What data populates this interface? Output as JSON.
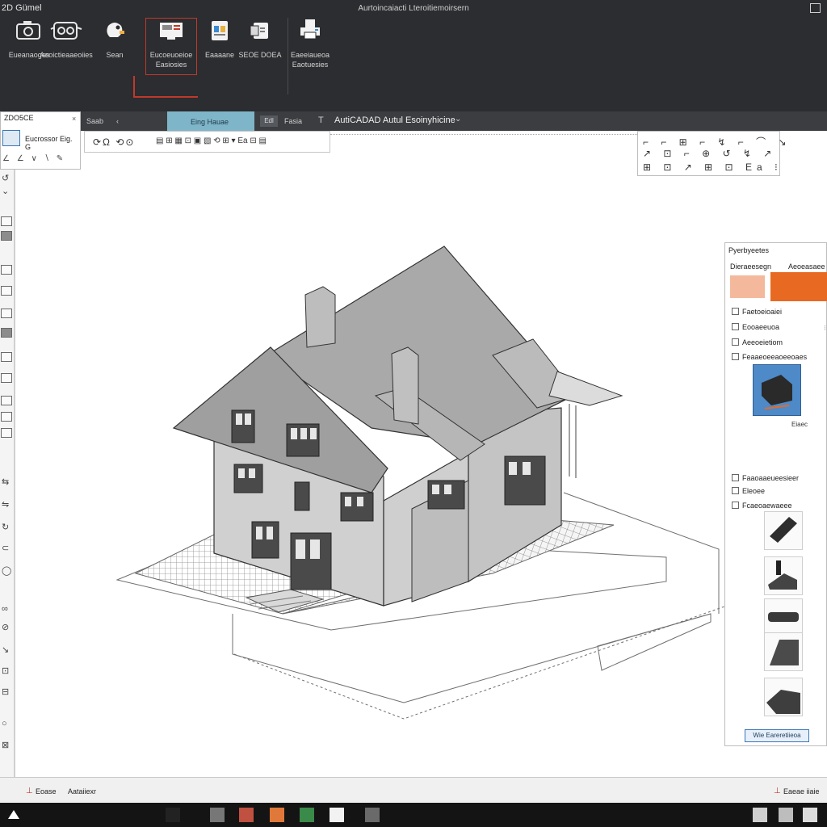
{
  "window": {
    "app_title": "2D Gümel",
    "title": "Aurtoincaiacti Lteroitiemoirsern"
  },
  "ribbon": {
    "buttons": [
      {
        "label": "Eueanaoges",
        "icon": "camera-icon"
      },
      {
        "label": "Aeoictieaaeoiies",
        "icon": "vr-headset-icon"
      },
      {
        "label": "Sean",
        "icon": "paint-icon"
      },
      {
        "label": "Eucoeuoeioe\nEasiosies",
        "icon": "monitor-icon"
      },
      {
        "label": "Eaaaane",
        "icon": "document-icon"
      },
      {
        "label": "SEOE DOEA",
        "icon": "export-icon"
      },
      {
        "label": "Eaeeiaueoa\nEaotuesies",
        "icon": "printer-icon"
      }
    ]
  },
  "tabs": {
    "left1": "Saab",
    "left2": "‹",
    "active": "Eing Hauae",
    "small": "Edl",
    "file": "Fasia",
    "tee": "T",
    "doc": "AutiCADAD Autul Esoinyhicine",
    "caret": "⌄"
  },
  "left_panel": {
    "title": "ZDO5CE",
    "close": "×",
    "name": "Eucrossor Eig. G",
    "icons": "∠ ∠ ∨ ∖ ✎"
  },
  "toolbar": {
    "glyphs": "⟳Ω ⟲⊙",
    "boxes": "▤ ⊞ ▦ ⊡ ▣ ▧ ⟲ ⊞ ▾ Ea ⊟ ▤"
  },
  "palette": {
    "row1": "⌐ ⌐ ⊞ ⌐ ↯ ⌐ ⌒ ↘",
    "row2": "↗ ⊡ ⌐ ⊕ ↺ ↯ ↗",
    "row3": "⊞ ⊡ ↗ ⊞ ⊡ Ea ⁝"
  },
  "properties": {
    "title": "Pyerbyeetes",
    "tab1": "Dieraeesegn",
    "tab2": "Aeoeasaee",
    "items": [
      "Faetoeioaiei",
      "Eooaeeuoa",
      "Aeeoeietiom",
      "Feaaeoeeaoeeoaes",
      "Faaoaaeueesieer",
      "Eleoee",
      "Fcaeoaewaeee"
    ],
    "preview_label": "Eiaec",
    "button": "Wie Eareretiieoa"
  },
  "status": {
    "label1": "Eoase",
    "label2": "Aataiiexr",
    "right": "Eaeae iiaie"
  }
}
